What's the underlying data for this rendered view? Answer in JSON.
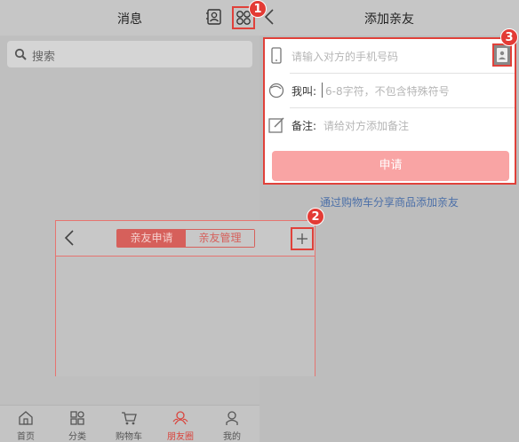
{
  "messages": {
    "title": "消息",
    "search_placeholder": "搜索"
  },
  "badges": {
    "one": "1",
    "two": "2",
    "three": "3"
  },
  "tabs": [
    {
      "label": "首页"
    },
    {
      "label": "分类"
    },
    {
      "label": "购物车"
    },
    {
      "label": "朋友圈"
    },
    {
      "label": "我的"
    }
  ],
  "friends": {
    "tab_requests": "亲友申请",
    "tab_manage": "亲友管理",
    "add_symbol": "+"
  },
  "add_friend": {
    "title": "添加亲友",
    "phone_placeholder": "请输入对方的手机号码",
    "call_label": "我叫:",
    "call_placeholder": "6-8字符，不包含特殊符号",
    "note_label": "备注:",
    "note_placeholder": "请给对方添加备注",
    "apply_label": "申请",
    "share_link": "通过购物车分享商品添加亲友"
  },
  "colors": {
    "accent": "#e0413a",
    "apply_button": "#f9a4a4",
    "link": "#4b6fa8",
    "active_tab": "#d9453e"
  }
}
